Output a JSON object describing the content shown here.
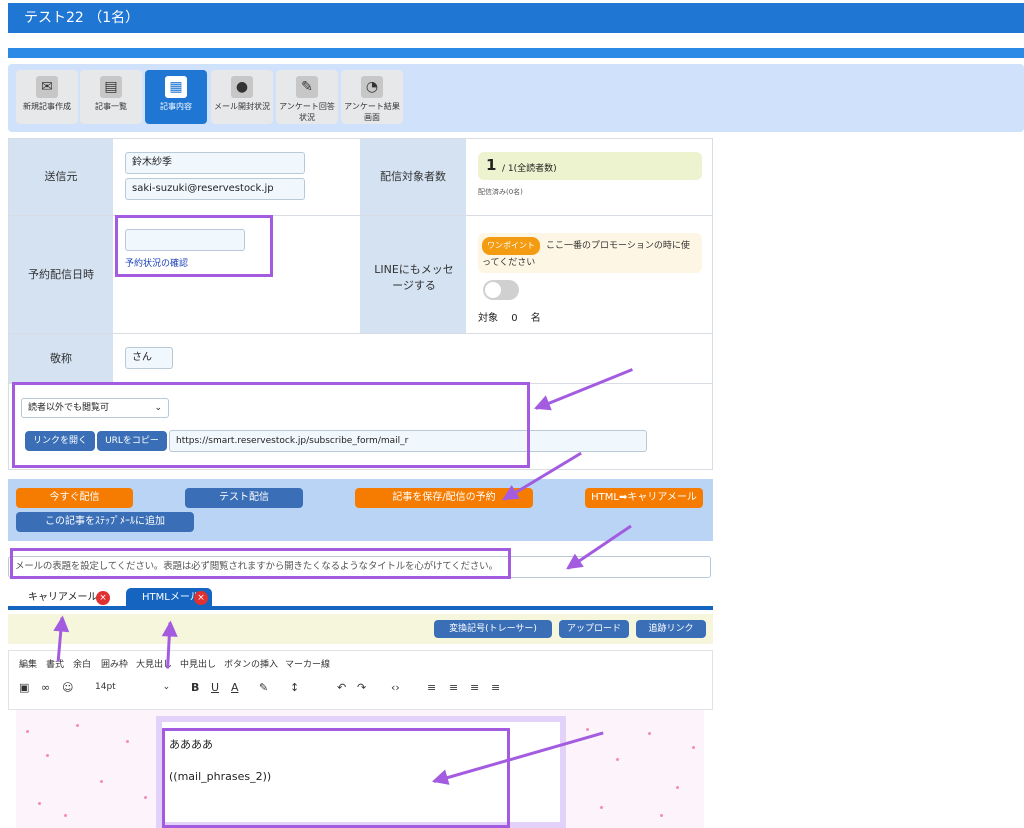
{
  "window": {
    "title": "テスト22 （1名）"
  },
  "toolbar": {
    "items": [
      {
        "label": "新規記事作成",
        "icon": "new-mail-icon",
        "glyph": "✉"
      },
      {
        "label": "記事一覧",
        "icon": "printer-icon",
        "glyph": "▤"
      },
      {
        "label": "記事内容",
        "icon": "newspaper-icon",
        "glyph": "▦"
      },
      {
        "label": "メール開封状況",
        "icon": "footprint-icon",
        "glyph": "●"
      },
      {
        "label": "アンケート回答状況",
        "icon": "survey-icon",
        "glyph": "✎"
      },
      {
        "label": "アンケート結果画面",
        "icon": "mouse-icon",
        "glyph": "◔"
      }
    ]
  },
  "form": {
    "sender_label": "送信元",
    "sender_name": "鈴木紗季",
    "sender_email": "saki-suzuki@reservestock.jp",
    "target_label": "配信対象者数",
    "target_count": "1",
    "target_total": "/ 1(全読者数)",
    "target_sent": "配信済み(0名)",
    "schedule_label": "予約配信日時",
    "schedule_value": "",
    "schedule_link": "予約状況の確認",
    "line_label": "LINEにもメッセージする",
    "tip_badge": "ワンポイント",
    "tip_text": "ここ一番のプロモーションの時に使ってください",
    "line_target_label": "対象",
    "line_target_count": "0",
    "line_target_unit": "名",
    "honorific_label": "敬称",
    "honorific_value": "さん",
    "visibility_value": "読者以外でも閲覧可",
    "open_link_button": "リンクを開く",
    "copy_url_button": "URLをコピー",
    "url_value": "https://smart.reservestock.jp/subscribe_form/mail_r"
  },
  "actions": {
    "send_now": "今すぐ配信",
    "test_send": "テスト配信",
    "save_schedule": "記事を保存/配信の予約",
    "html_to_carrier": "HTML➡キャリアメール",
    "add_to_step": "この記事をｽﾃｯﾌﾟﾒｰﾙに追加"
  },
  "subject": {
    "placeholder": "メールの表題を設定してください。表題は必ず閲覧されますから開きたくなるようなタイトルを心がけてください。"
  },
  "tabs": [
    {
      "label": "キャリアメール"
    },
    {
      "label": "HTMLメール"
    }
  ],
  "editor_buttons": {
    "convert": "変換記号(トレーサー)",
    "upload": "アップロード",
    "tracking": "追跡リンク"
  },
  "menu": [
    "編集",
    "書式",
    "余白",
    "囲み枠",
    "大見出し",
    "中見出し",
    "ボタンの挿入",
    "マーカー線"
  ],
  "format": {
    "font_size": "14pt"
  },
  "body": {
    "line1": "ああああ",
    "line2": "((mail_phrases_2))"
  },
  "colors": {
    "accent": "#1f76d3",
    "annotation": "#a35ce0",
    "orange": "#f57c00"
  }
}
